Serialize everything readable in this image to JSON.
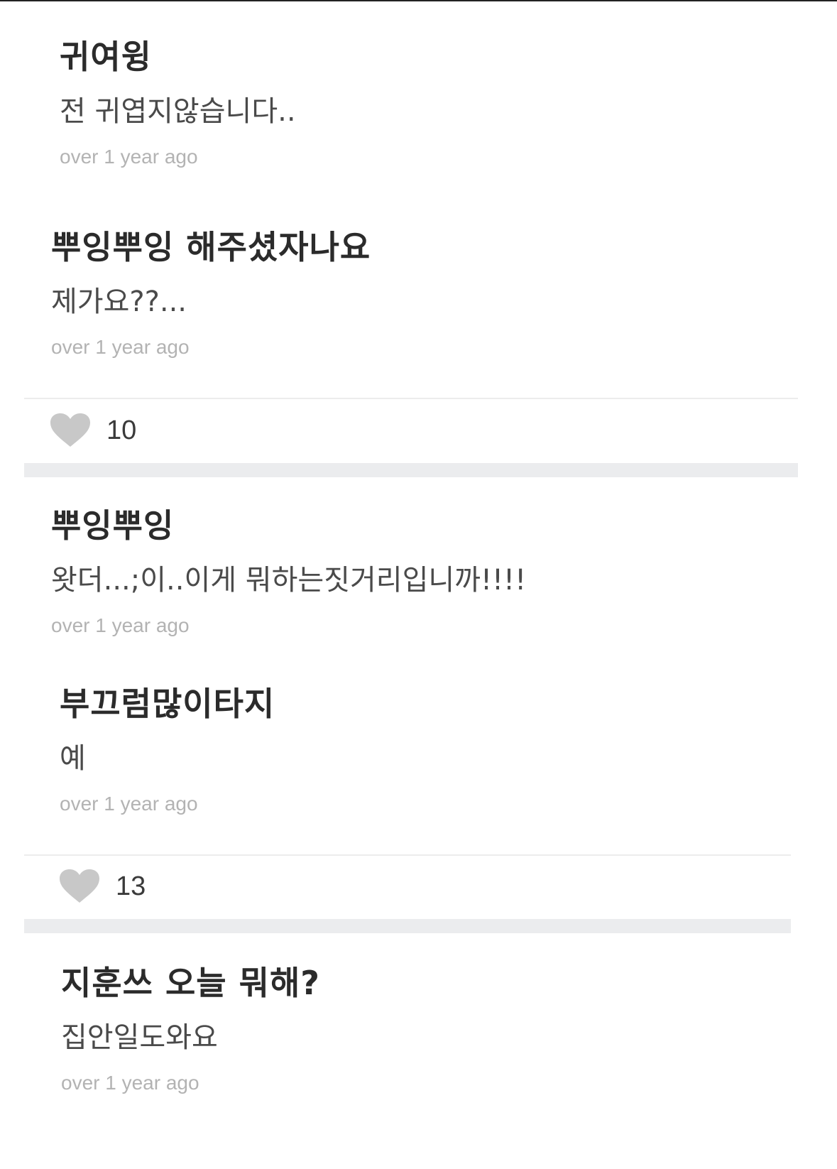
{
  "comments": [
    {
      "question": "귀여윙",
      "answer": "전 귀엽지않습니다..",
      "time": "over 1 year ago"
    },
    {
      "question": "뿌잉뿌잉 해주셨자나요",
      "answer": "제가요??...",
      "time": "over 1 year ago"
    },
    {
      "question": "뿌잉뿌잉",
      "answer": "왓더...;이..이게 뭐하는짓거리입니까!!!!",
      "time": "over 1 year ago"
    },
    {
      "question": "부끄럼많이타지",
      "answer": "예",
      "time": "over 1 year ago"
    },
    {
      "question": "지훈쓰 오늘 뭐해?",
      "answer": "집안일도와요",
      "time": "over 1 year ago"
    }
  ],
  "likes": [
    {
      "icon": "heart-icon",
      "count": "10"
    },
    {
      "icon": "heart-icon",
      "count": "13"
    }
  ],
  "colors": {
    "heart": "#c8c8c8",
    "timestamp": "#b3b3b3",
    "band": "#ebecee"
  }
}
